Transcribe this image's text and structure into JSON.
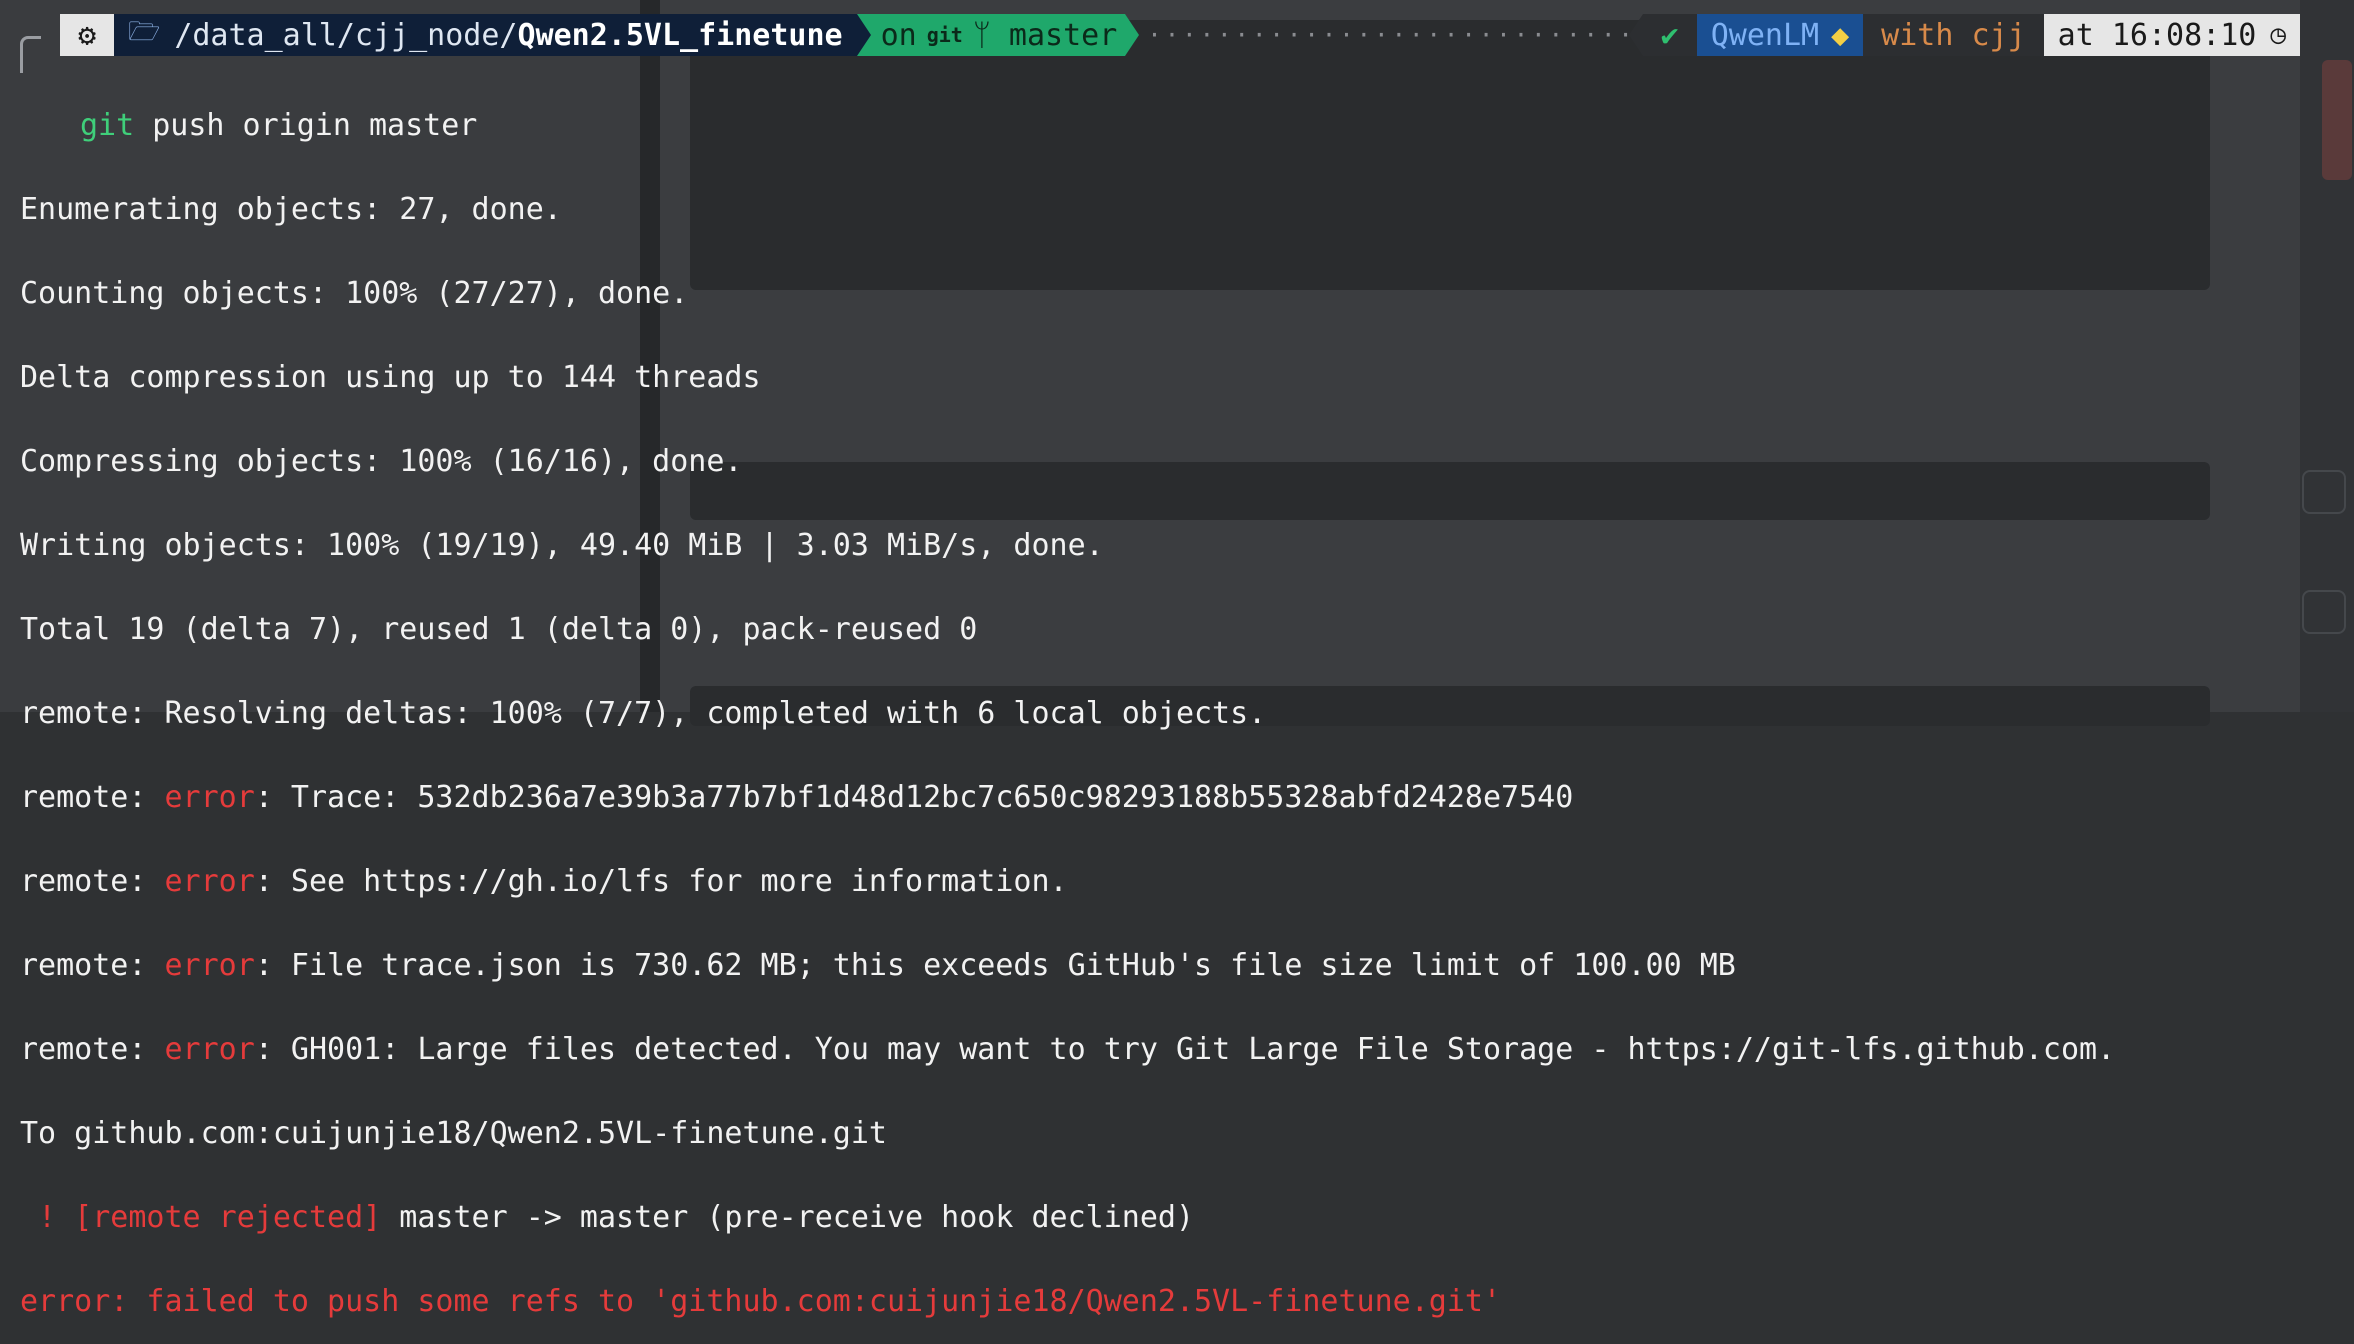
{
  "prompt": {
    "os_icon": "linux-logo-icon",
    "folder_icon": "folder-open-icon",
    "path_prefix": "/data_all/cjj_node/",
    "path_current": "Qwen2.5VL_finetune",
    "git_prefix": "on",
    "git_icon": "git",
    "branch_icon": "branch-icon",
    "branch": "master",
    "dots": "··········································································",
    "check": "✔",
    "env": "QwenLM",
    "env_icon": "python-icon",
    "user": "with cjj",
    "time": "at 16:08:10",
    "clock_icon": "clock-icon"
  },
  "terminal": {
    "command_git": "git",
    "command_rest": " push origin master",
    "lines": [
      "Enumerating objects: 27, done.",
      "Counting objects: 100% (27/27), done.",
      "Delta compression using up to 144 threads",
      "Compressing objects: 100% (16/16), done.",
      "Writing objects: 100% (19/19), 49.40 MiB | 3.03 MiB/s, done.",
      "Total 19 (delta 7), reused 1 (delta 0), pack-reused 0",
      "remote: Resolving deltas: 100% (7/7), completed with 6 local objects."
    ],
    "remote_prefix": "remote: ",
    "error_word": "error",
    "error_lines": [
      ": Trace: 532db236a7e39b3a77b7bf1d48d12bc7c650c98293188b55328abfd2428e7540",
      ": See https://gh.io/lfs for more information.",
      ": File trace.json is 730.62 MB; this exceeds GitHub's file size limit of 100.00 MB",
      ": GH001: Large files detected. You may want to try Git Large File Storage - https://git-lfs.github.com."
    ],
    "to_line": "To github.com:cuijunjie18/Qwen2.5VL-finetune.git",
    "rejected_prefix": " ! [remote rejected]",
    "rejected_rest": " master -> master (pre-receive hook declined)",
    "final_error": "error: failed to push some refs to 'github.com:cuijunjie18/Qwen2.5VL-finetune.git'"
  }
}
